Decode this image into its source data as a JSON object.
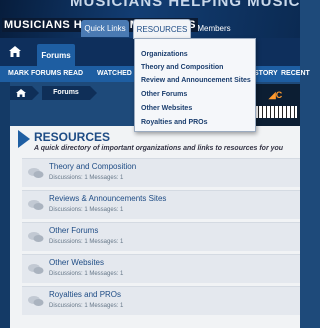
{
  "header": {
    "logo_top": "MUSICIANS HELPING MUSICIANS",
    "tagline": "MUSICIANS HELPING MUSICIANS"
  },
  "nav": {
    "forums": "Forums",
    "quick_links": "Quick Links",
    "resources": "RESOURCES",
    "members": "Members"
  },
  "subnav": {
    "mark_read": "MARK FORUMS READ",
    "watched": "WATCHED F",
    "story": "STORY",
    "recent": "RECENT"
  },
  "breadcrumb": {
    "forums": "Forums"
  },
  "resources_menu": [
    {
      "label": "Organizations"
    },
    {
      "label": "Theory and Composition"
    },
    {
      "label": "Review and Announcement Sites"
    },
    {
      "label": "Other Forums"
    },
    {
      "label": "Other Websites"
    },
    {
      "label": "Royalties and PROs"
    }
  ],
  "section": {
    "title": "RESOURCES",
    "description": "A quick directory of important organizations and links to resources for you"
  },
  "nodes": [
    {
      "title": "Theory and Composition",
      "stats": "Discussions: 1   Messages: 1"
    },
    {
      "title": "Reviews & Announcements Sites",
      "stats": "Discussions: 1   Messages: 1"
    },
    {
      "title": "Other Forums",
      "stats": "Discussions: 1   Messages: 1"
    },
    {
      "title": "Other Websites",
      "stats": "Discussions: 1   Messages: 1"
    },
    {
      "title": "Royalties and PROs",
      "stats": "Discussions: 1   Messages: 1"
    }
  ],
  "colors": {
    "nav_bg": "#0e2f5c",
    "accent": "#1e5ea2",
    "dropdown_bg": "#f5f7fa",
    "link": "#1e4c85"
  },
  "icons": {
    "home": "home-icon",
    "node": "chat-bubbles-icon"
  }
}
